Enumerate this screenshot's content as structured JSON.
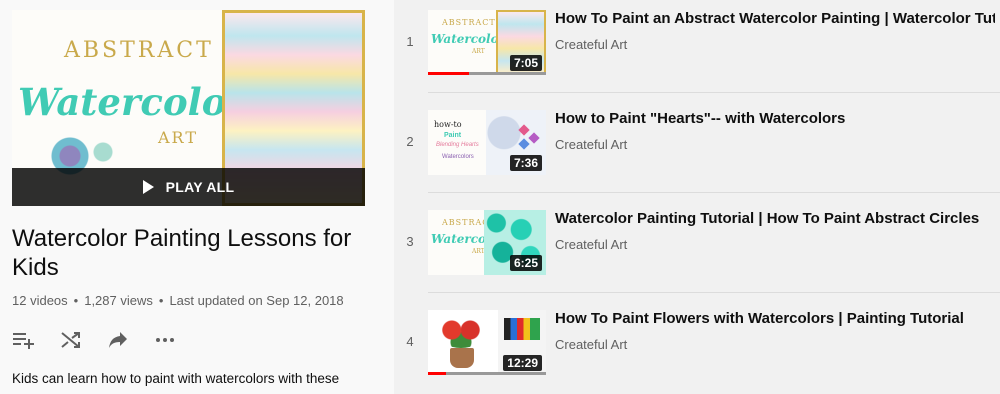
{
  "playlist": {
    "hero_text": {
      "line1": "ABSTRACT",
      "line2": "Watercolor",
      "line3": "ART"
    },
    "play_all_label": "PLAY ALL",
    "title": "Watercolor Painting Lessons for Kids",
    "meta": {
      "videos": "12 videos",
      "views": "1,287 views",
      "updated": "Last updated on Sep 12, 2018",
      "separator": "•"
    },
    "actions": [
      {
        "name": "add-to-queue-icon"
      },
      {
        "name": "shuffle-icon"
      },
      {
        "name": "share-icon"
      },
      {
        "name": "more-icon"
      }
    ],
    "description": "Kids can learn how to paint with watercolors with these"
  },
  "videos": [
    {
      "index": "1",
      "title": "How To Paint an Abstract Watercolor Painting | Watercolor Tuto",
      "channel": "Createful Art",
      "duration": "7:05",
      "progress": 0.35,
      "thumb_text": [
        "ABSTRACT",
        "Watercolor",
        "ART"
      ]
    },
    {
      "index": "2",
      "title": "How to Paint \"Hearts\"-- with Watercolors",
      "channel": "Createful Art",
      "duration": "7:36",
      "progress": 0
    },
    {
      "index": "3",
      "title": "Watercolor Painting Tutorial | How To Paint Abstract Circles",
      "channel": "Createful Art",
      "duration": "6:25",
      "progress": 0,
      "thumb_text": [
        "ABSTRACT",
        "Watercolor",
        "ART"
      ]
    },
    {
      "index": "4",
      "title": "How To Paint Flowers with Watercolors | Painting Tutorial",
      "channel": "Createful Art",
      "duration": "12:29",
      "progress": 0.15
    }
  ],
  "colors": {
    "progress_red": "#ff0000",
    "accent_teal": "#40cbb4",
    "gold": "#c9a94b"
  }
}
